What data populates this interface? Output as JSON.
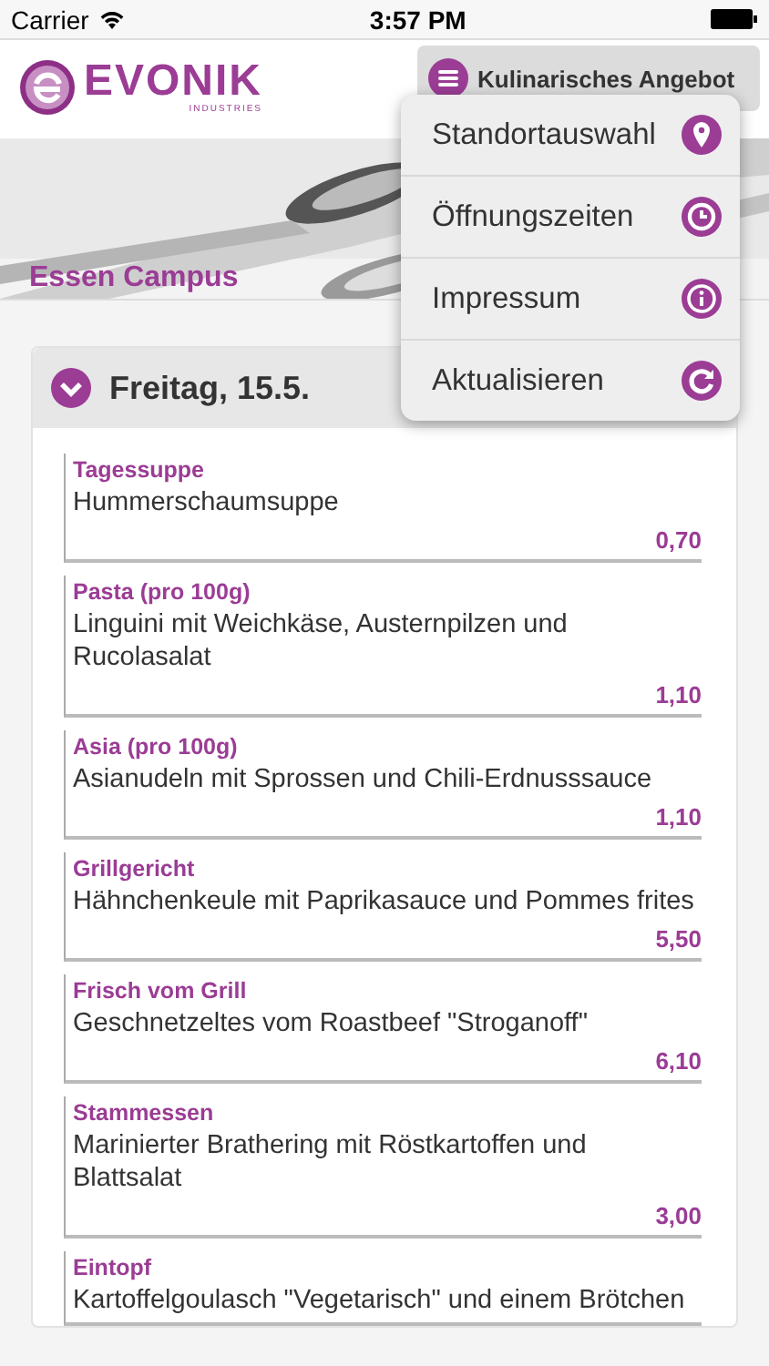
{
  "status_bar": {
    "carrier": "Carrier",
    "time": "3:57 PM"
  },
  "header": {
    "logo_text": "EVONIK",
    "logo_subtext": "INDUSTRIES",
    "menu_button": "Kulinarisches Angebot"
  },
  "banner": {
    "location": "Essen Campus"
  },
  "menu": {
    "open": true,
    "items": [
      {
        "label": "Standortauswahl",
        "kind": "location"
      },
      {
        "label": "Öffnungszeiten",
        "kind": "clock"
      },
      {
        "label": "Impressum",
        "kind": "info"
      },
      {
        "label": "Aktualisieren",
        "kind": "refresh"
      }
    ]
  },
  "day": {
    "title": "Freitag, 15.5.",
    "expanded": true
  },
  "dishes": [
    {
      "category": "Tagessuppe",
      "name": "Hummerschaumsuppe",
      "price": "0,70"
    },
    {
      "category": "Pasta (pro 100g)",
      "name": "Linguini mit Weichkäse, Austernpilzen und Rucolasalat",
      "price": "1,10"
    },
    {
      "category": "Asia (pro 100g)",
      "name": "Asianudeln mit Sprossen und Chili-Erdnusssauce",
      "price": "1,10"
    },
    {
      "category": "Grillgericht",
      "name": "Hähnchenkeule mit Paprikasauce und Pommes frites",
      "price": "5,50"
    },
    {
      "category": "Frisch vom Grill",
      "name": "Geschnetzeltes vom Roastbeef \"Stroganoff\"",
      "price": "6,10"
    },
    {
      "category": "Stammessen",
      "name": "Marinierter Brathering mit Röstkartoffen und Blattsalat",
      "price": "3,00"
    },
    {
      "category": "Eintopf",
      "name": "Kartoffelgoulasch \"Vegetarisch\" und einem Brötchen"
    }
  ]
}
